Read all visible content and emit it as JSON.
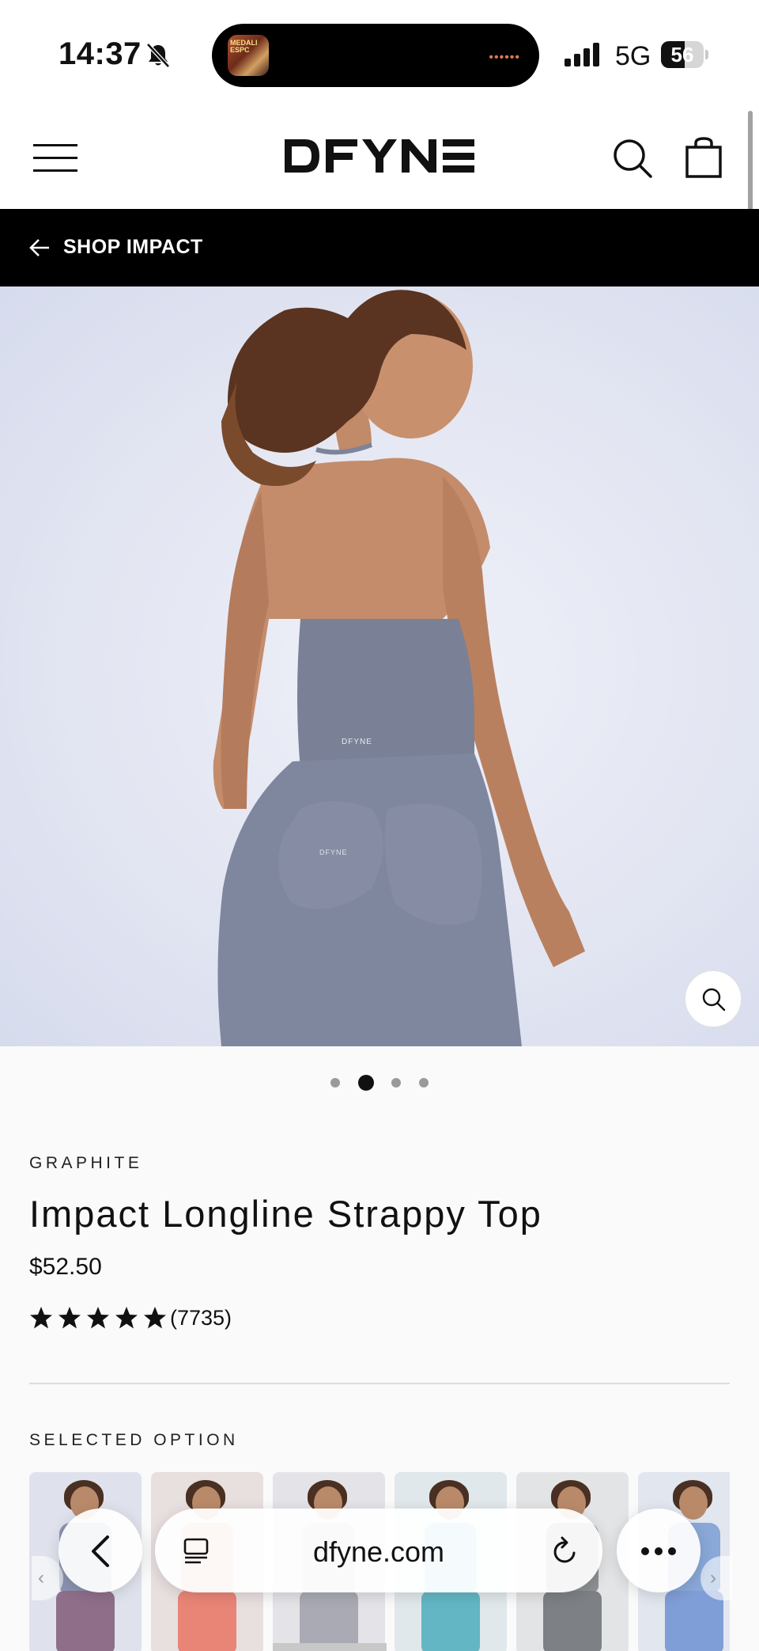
{
  "status_bar": {
    "time": "14:37",
    "network": "5G",
    "battery_percent": "56",
    "battery_level": 0.56,
    "island_thumb_text": "MEDALI ESPC"
  },
  "header": {
    "brand": "DFYNE",
    "icons": [
      "menu-icon",
      "search-icon",
      "bag-icon"
    ]
  },
  "back_bar": {
    "label": "SHOP IMPACT"
  },
  "gallery": {
    "image_alt": "model wearing graphite longline top, back view",
    "dot_count": 4,
    "active_index": 1
  },
  "product": {
    "color": "GRAPHITE",
    "title": "Impact Longline Strappy Top",
    "price": "$52.50",
    "rating": 5,
    "review_count": "(7735)"
  },
  "options": {
    "label": "SELECTED OPTION",
    "swatches": [
      {
        "name": "graphite",
        "top": "#8a93b0",
        "bottom": "#8f6e8a",
        "bg": "#dfe2ec"
      },
      {
        "name": "coral",
        "top": "#e59a8c",
        "bottom": "#e98577",
        "bg": "#e8dfdf"
      },
      {
        "name": "grey",
        "top": "#b9bac1",
        "bottom": "#a9aab3",
        "bg": "#e4e4e8"
      },
      {
        "name": "aqua",
        "top": "#7fc9d1",
        "bottom": "#63b7c4",
        "bg": "#e0e8ec"
      },
      {
        "name": "slate",
        "top": "#8d9094",
        "bottom": "#7d8085",
        "bg": "#e3e4e6"
      },
      {
        "name": "blue",
        "top": "#8aa8d8",
        "bottom": "#7f9dd6",
        "bg": "#e1e6ef"
      }
    ]
  },
  "browser": {
    "url": "dfyne.com"
  },
  "colors": {
    "accent": "#000000",
    "background": "#fafafb"
  }
}
